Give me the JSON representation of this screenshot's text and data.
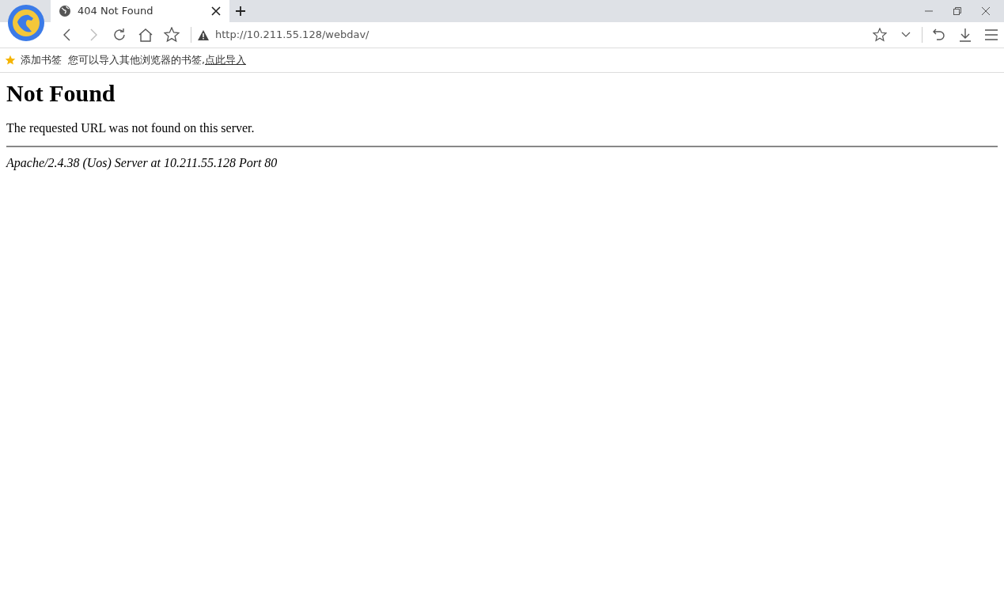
{
  "tabs": [
    {
      "title": "404 Not Found",
      "selected": true
    }
  ],
  "address_bar": {
    "url": "http://10.211.55.128/webdav/"
  },
  "bookmarks_bar": {
    "label": "添加书签",
    "message": "您可以导入其他浏览器的书签,",
    "link": "点此导入"
  },
  "page": {
    "heading": "Not Found",
    "message": "The requested URL was not found on this server.",
    "address": "Apache/2.4.38 (Uos) Server at 10.211.55.128 Port 80"
  }
}
